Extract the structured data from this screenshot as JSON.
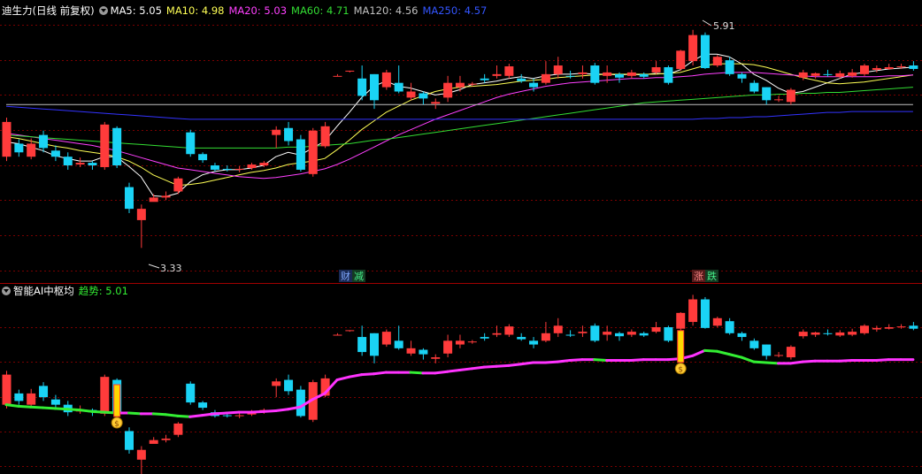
{
  "main_header": {
    "title": "迪生力(日线 前复权)",
    "ma5": "MA5: 5.05",
    "ma10": "MA10: 4.98",
    "ma20": "MA20: 5.03",
    "ma60": "MA60: 4.71",
    "ma120": "MA120: 4.56",
    "ma250": "MA250: 4.57"
  },
  "sub_header": {
    "title": "智能AI中枢均",
    "trend": "趋势: 5.01"
  },
  "annotations": {
    "high_label": "5.91",
    "low_label": "3.33",
    "mark_cai": "财",
    "mark_jian": "减",
    "mark_zhang": "涨",
    "mark_die": "跌"
  },
  "colors": {
    "up": "#ff3b3b",
    "down": "#1ad3f5",
    "ma5": "#ffffff",
    "ma10": "#ffff55",
    "ma20": "#ff40ff",
    "ma60": "#33dd33",
    "ma120": "#c0c0c0",
    "ma250": "#3333ff",
    "grid": "#7a0000",
    "trend_up": "#ff33ff",
    "trend_down": "#33ee33"
  },
  "chart_data": [
    {
      "type": "candlestick",
      "title": "迪生力(日线 前复权)",
      "ylim": [
        3.2,
        6.05
      ],
      "legend": [
        "MA5",
        "MA10",
        "MA20",
        "MA60",
        "MA120",
        "MA250"
      ],
      "candles": [
        [
          4.45,
          4.85,
          4.9,
          4.4
        ],
        [
          4.6,
          4.5,
          4.65,
          4.45
        ],
        [
          4.45,
          4.6,
          4.66,
          4.42
        ],
        [
          4.7,
          4.55,
          4.75,
          4.5
        ],
        [
          4.52,
          4.45,
          4.58,
          4.4
        ],
        [
          4.45,
          4.35,
          4.5,
          4.3
        ],
        [
          4.36,
          4.38,
          4.44,
          4.33
        ],
        [
          4.38,
          4.35,
          4.4,
          4.3
        ],
        [
          4.33,
          4.82,
          4.85,
          4.3
        ],
        [
          4.78,
          4.35,
          4.8,
          4.32
        ],
        [
          4.1,
          3.85,
          4.15,
          3.8
        ],
        [
          3.72,
          3.85,
          3.9,
          3.4
        ],
        [
          3.93,
          3.98,
          4.02,
          3.95
        ],
        [
          3.98,
          4.0,
          4.05,
          3.95
        ],
        [
          4.05,
          4.2,
          4.22,
          4.02
        ],
        [
          4.73,
          4.48,
          4.76,
          4.45
        ],
        [
          4.48,
          4.41,
          4.5,
          4.38
        ],
        [
          4.35,
          4.3,
          4.38,
          4.28
        ],
        [
          4.31,
          4.3,
          4.35,
          4.28
        ],
        [
          4.3,
          4.31,
          4.34,
          4.27
        ],
        [
          4.32,
          4.36,
          4.38,
          4.3
        ],
        [
          4.35,
          4.38,
          4.4,
          4.33
        ],
        [
          4.7,
          4.76,
          4.8,
          4.55
        ],
        [
          4.78,
          4.63,
          4.85,
          4.58
        ],
        [
          4.65,
          4.3,
          4.7,
          4.28
        ],
        [
          4.25,
          4.75,
          4.78,
          4.22
        ],
        [
          4.57,
          4.8,
          4.85,
          4.55
        ],
        [
          5.38,
          5.38,
          5.4,
          5.38
        ],
        [
          5.43,
          5.44,
          5.44,
          5.42
        ],
        [
          5.35,
          5.15,
          5.5,
          5.1
        ],
        [
          5.4,
          5.1,
          5.4,
          5.0
        ],
        [
          5.25,
          5.42,
          5.45,
          5.22
        ],
        [
          5.3,
          5.2,
          5.5,
          5.18
        ],
        [
          5.13,
          5.2,
          5.3,
          5.1
        ],
        [
          5.18,
          5.12,
          5.2,
          5.05
        ],
        [
          5.06,
          5.08,
          5.12,
          5.0
        ],
        [
          5.13,
          5.3,
          5.38,
          5.08
        ],
        [
          5.25,
          5.3,
          5.38,
          5.2
        ],
        [
          5.28,
          5.29,
          5.31,
          5.26
        ],
        [
          5.35,
          5.33,
          5.4,
          5.3
        ],
        [
          5.38,
          5.4,
          5.5,
          5.35
        ],
        [
          5.38,
          5.49,
          5.52,
          5.35
        ],
        [
          5.35,
          5.32,
          5.4,
          5.3
        ],
        [
          5.3,
          5.25,
          5.35,
          5.2
        ],
        [
          5.3,
          5.4,
          5.55,
          5.28
        ],
        [
          5.4,
          5.5,
          5.6,
          5.35
        ],
        [
          5.38,
          5.37,
          5.44,
          5.35
        ],
        [
          5.4,
          5.42,
          5.5,
          5.35
        ],
        [
          5.5,
          5.3,
          5.53,
          5.28
        ],
        [
          5.38,
          5.42,
          5.5,
          5.3
        ],
        [
          5.4,
          5.36,
          5.42,
          5.3
        ],
        [
          5.38,
          5.42,
          5.45,
          5.35
        ],
        [
          5.4,
          5.37,
          5.42,
          5.35
        ],
        [
          5.42,
          5.48,
          5.55,
          5.4
        ],
        [
          5.48,
          5.3,
          5.5,
          5.28
        ],
        [
          5.46,
          5.67,
          5.68,
          5.44
        ],
        [
          5.55,
          5.85,
          5.91,
          5.5
        ],
        [
          5.85,
          5.47,
          5.88,
          5.46
        ],
        [
          5.5,
          5.6,
          5.62,
          5.48
        ],
        [
          5.56,
          5.4,
          5.6,
          5.38
        ],
        [
          5.4,
          5.35,
          5.42,
          5.3
        ],
        [
          5.3,
          5.2,
          5.33,
          5.18
        ],
        [
          5.25,
          5.1,
          5.25,
          5.05
        ],
        [
          5.11,
          5.11,
          5.15,
          5.08
        ],
        [
          5.08,
          5.22,
          5.24,
          5.05
        ],
        [
          5.36,
          5.42,
          5.45,
          5.33
        ],
        [
          5.38,
          5.41,
          5.42,
          5.35
        ],
        [
          5.4,
          5.39,
          5.45,
          5.37
        ],
        [
          5.37,
          5.41,
          5.44,
          5.35
        ],
        [
          5.38,
          5.42,
          5.46,
          5.36
        ],
        [
          5.4,
          5.5,
          5.52,
          5.38
        ],
        [
          5.45,
          5.47,
          5.5,
          5.42
        ],
        [
          5.46,
          5.48,
          5.52,
          5.45
        ],
        [
          5.48,
          5.49,
          5.52,
          5.46
        ],
        [
          5.5,
          5.46,
          5.55,
          5.44
        ]
      ],
      "ma": {
        "MA5": [
          4.62,
          4.6,
          4.56,
          4.52,
          4.46,
          4.43,
          4.4,
          4.4,
          4.45,
          4.45,
          4.34,
          4.22,
          4.0,
          3.99,
          4.03,
          4.16,
          4.24,
          4.28,
          4.3,
          4.3,
          4.32,
          4.35,
          4.45,
          4.5,
          4.47,
          4.55,
          4.63,
          4.8,
          4.96,
          5.13,
          5.26,
          5.32,
          5.26,
          5.24,
          5.2,
          5.16,
          5.18,
          5.22,
          5.28,
          5.3,
          5.32,
          5.35,
          5.37,
          5.35,
          5.38,
          5.4,
          5.4,
          5.41,
          5.4,
          5.4,
          5.39,
          5.4,
          5.39,
          5.41,
          5.4,
          5.45,
          5.55,
          5.63,
          5.63,
          5.6,
          5.52,
          5.4,
          5.33,
          5.24,
          5.18,
          5.2,
          5.25,
          5.3,
          5.35,
          5.4,
          5.42,
          5.44,
          5.46,
          5.47,
          5.48
        ],
        "MA10": [
          4.68,
          4.66,
          4.63,
          4.6,
          4.57,
          4.55,
          4.52,
          4.5,
          4.48,
          4.45,
          4.4,
          4.33,
          4.24,
          4.18,
          4.12,
          4.13,
          4.15,
          4.18,
          4.21,
          4.24,
          4.27,
          4.29,
          4.32,
          4.36,
          4.38,
          4.4,
          4.43,
          4.53,
          4.64,
          4.76,
          4.86,
          4.96,
          5.03,
          5.1,
          5.15,
          5.2,
          5.23,
          5.25,
          5.26,
          5.27,
          5.28,
          5.3,
          5.32,
          5.33,
          5.34,
          5.36,
          5.37,
          5.38,
          5.39,
          5.4,
          5.4,
          5.4,
          5.4,
          5.4,
          5.41,
          5.42,
          5.46,
          5.5,
          5.52,
          5.52,
          5.52,
          5.51,
          5.48,
          5.44,
          5.4,
          5.36,
          5.33,
          5.3,
          5.29,
          5.3,
          5.31,
          5.33,
          5.35,
          5.37,
          5.39
        ],
        "MA20": [
          4.72,
          4.7,
          4.68,
          4.66,
          4.64,
          4.62,
          4.6,
          4.58,
          4.55,
          4.52,
          4.48,
          4.44,
          4.4,
          4.36,
          4.32,
          4.3,
          4.28,
          4.26,
          4.24,
          4.22,
          4.21,
          4.2,
          4.21,
          4.23,
          4.25,
          4.28,
          4.31,
          4.36,
          4.42,
          4.49,
          4.56,
          4.63,
          4.7,
          4.76,
          4.82,
          4.88,
          4.93,
          4.98,
          5.03,
          5.08,
          5.13,
          5.17,
          5.2,
          5.23,
          5.26,
          5.28,
          5.3,
          5.31,
          5.32,
          5.33,
          5.34,
          5.35,
          5.35,
          5.36,
          5.36,
          5.37,
          5.38,
          5.4,
          5.41,
          5.42,
          5.42,
          5.42,
          5.41,
          5.4,
          5.39,
          5.38,
          5.37,
          5.37,
          5.37,
          5.37,
          5.37,
          5.37,
          5.38,
          5.38,
          5.39
        ],
        "MA60": [
          4.7,
          4.69,
          4.68,
          4.67,
          4.66,
          4.65,
          4.64,
          4.63,
          4.62,
          4.61,
          4.6,
          4.59,
          4.58,
          4.57,
          4.56,
          4.55,
          4.55,
          4.55,
          4.55,
          4.55,
          4.55,
          4.55,
          4.55,
          4.56,
          4.56,
          4.57,
          4.58,
          4.59,
          4.6,
          4.62,
          4.64,
          4.65,
          4.67,
          4.69,
          4.71,
          4.73,
          4.75,
          4.77,
          4.79,
          4.81,
          4.83,
          4.85,
          4.87,
          4.89,
          4.91,
          4.93,
          4.95,
          4.97,
          4.99,
          5.01,
          5.03,
          5.05,
          5.07,
          5.08,
          5.09,
          5.1,
          5.11,
          5.12,
          5.13,
          5.14,
          5.15,
          5.16,
          5.16,
          5.17,
          5.17,
          5.18,
          5.18,
          5.19,
          5.19,
          5.2,
          5.21,
          5.22,
          5.23,
          5.24,
          5.25
        ],
        "MA120": [
          5.05,
          5.05,
          5.05,
          5.05,
          5.05,
          5.05,
          5.05,
          5.05,
          5.05,
          5.05,
          5.05,
          5.05,
          5.05,
          5.05,
          5.05,
          5.05,
          5.05,
          5.05,
          5.05,
          5.05,
          5.05,
          5.05,
          5.05,
          5.05,
          5.05,
          5.05,
          5.05,
          5.05,
          5.05,
          5.05,
          5.05,
          5.05,
          5.05,
          5.05,
          5.05,
          5.05,
          5.05,
          5.05,
          5.05,
          5.05,
          5.05,
          5.05,
          5.05,
          5.05,
          5.05,
          5.05,
          5.05,
          5.05,
          5.05,
          5.05,
          5.05,
          5.05,
          5.05,
          5.05,
          5.05,
          5.05,
          5.05,
          5.05,
          5.05,
          5.05,
          5.05,
          5.05,
          5.05,
          5.05,
          5.05,
          5.05,
          5.05,
          5.05,
          5.05,
          5.05,
          5.05,
          5.05,
          5.05,
          5.05,
          5.05
        ],
        "MA250": [
          5.03,
          5.02,
          5.01,
          5.0,
          4.99,
          4.98,
          4.97,
          4.96,
          4.95,
          4.94,
          4.93,
          4.92,
          4.91,
          4.9,
          4.89,
          4.88,
          4.88,
          4.88,
          4.88,
          4.88,
          4.88,
          4.88,
          4.88,
          4.88,
          4.88,
          4.88,
          4.88,
          4.88,
          4.88,
          4.88,
          4.88,
          4.88,
          4.88,
          4.88,
          4.88,
          4.88,
          4.88,
          4.88,
          4.88,
          4.88,
          4.88,
          4.88,
          4.88,
          4.88,
          4.88,
          4.88,
          4.88,
          4.88,
          4.88,
          4.88,
          4.88,
          4.88,
          4.88,
          4.88,
          4.88,
          4.88,
          4.88,
          4.89,
          4.89,
          4.9,
          4.9,
          4.91,
          4.91,
          4.92,
          4.93,
          4.94,
          4.95,
          4.96,
          4.96,
          4.97,
          4.97,
          4.97,
          4.97,
          4.97,
          4.97
        ]
      }
    },
    {
      "type": "candlestick",
      "title": "智能AI中枢均",
      "series_name": "趋势",
      "last_value": 5.01,
      "trend": [
        4.45,
        4.43,
        4.42,
        4.41,
        4.4,
        4.39,
        4.38,
        4.36,
        4.35,
        4.34,
        4.34,
        4.33,
        4.33,
        4.32,
        4.3,
        4.29,
        4.31,
        4.33,
        4.34,
        4.35,
        4.35,
        4.36,
        4.37,
        4.39,
        4.42,
        4.52,
        4.6,
        4.78,
        4.82,
        4.85,
        4.86,
        4.88,
        4.88,
        4.88,
        4.87,
        4.87,
        4.89,
        4.91,
        4.93,
        4.95,
        4.96,
        4.97,
        4.99,
        5.01,
        5.01,
        5.02,
        5.04,
        5.05,
        5.05,
        5.04,
        5.04,
        5.04,
        5.05,
        5.05,
        5.05,
        5.06,
        5.1,
        5.17,
        5.16,
        5.12,
        5.08,
        5.02,
        5.01,
        5.0,
        5.0,
        5.02,
        5.03,
        5.03,
        5.03,
        5.04,
        5.04,
        5.04,
        5.05,
        5.05,
        5.05
      ],
      "signals": [
        9,
        55
      ]
    }
  ]
}
